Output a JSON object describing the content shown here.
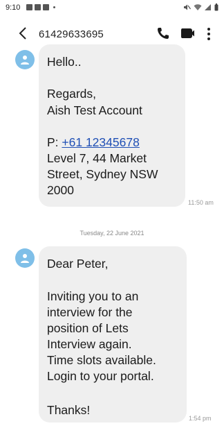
{
  "status_bar": {
    "time": "9:10"
  },
  "header": {
    "contact_number": "61429633695"
  },
  "messages": [
    {
      "greeting": "Hello..",
      "sign_off": "Regards,",
      "sender_name": "Aish Test Account",
      "phone_prefix": "P: ",
      "phone_link": "+61 12345678",
      "address": "Level 7, 44 Market\nStreet, Sydney NSW\n2000",
      "time": "11:50 am"
    },
    {
      "greeting": "Dear Peter,",
      "body": "Inviting you to an\ninterview for the\nposition of Lets\nInterview again.\nTime slots available.\nLogin to your portal.",
      "closing": "Thanks!",
      "time": "1:54 pm"
    }
  ],
  "date_separator": "Tuesday, 22 June 2021",
  "colors": {
    "avatar": "#7fbfe8",
    "bubble": "#efefef",
    "link": "#1f4fb5"
  }
}
